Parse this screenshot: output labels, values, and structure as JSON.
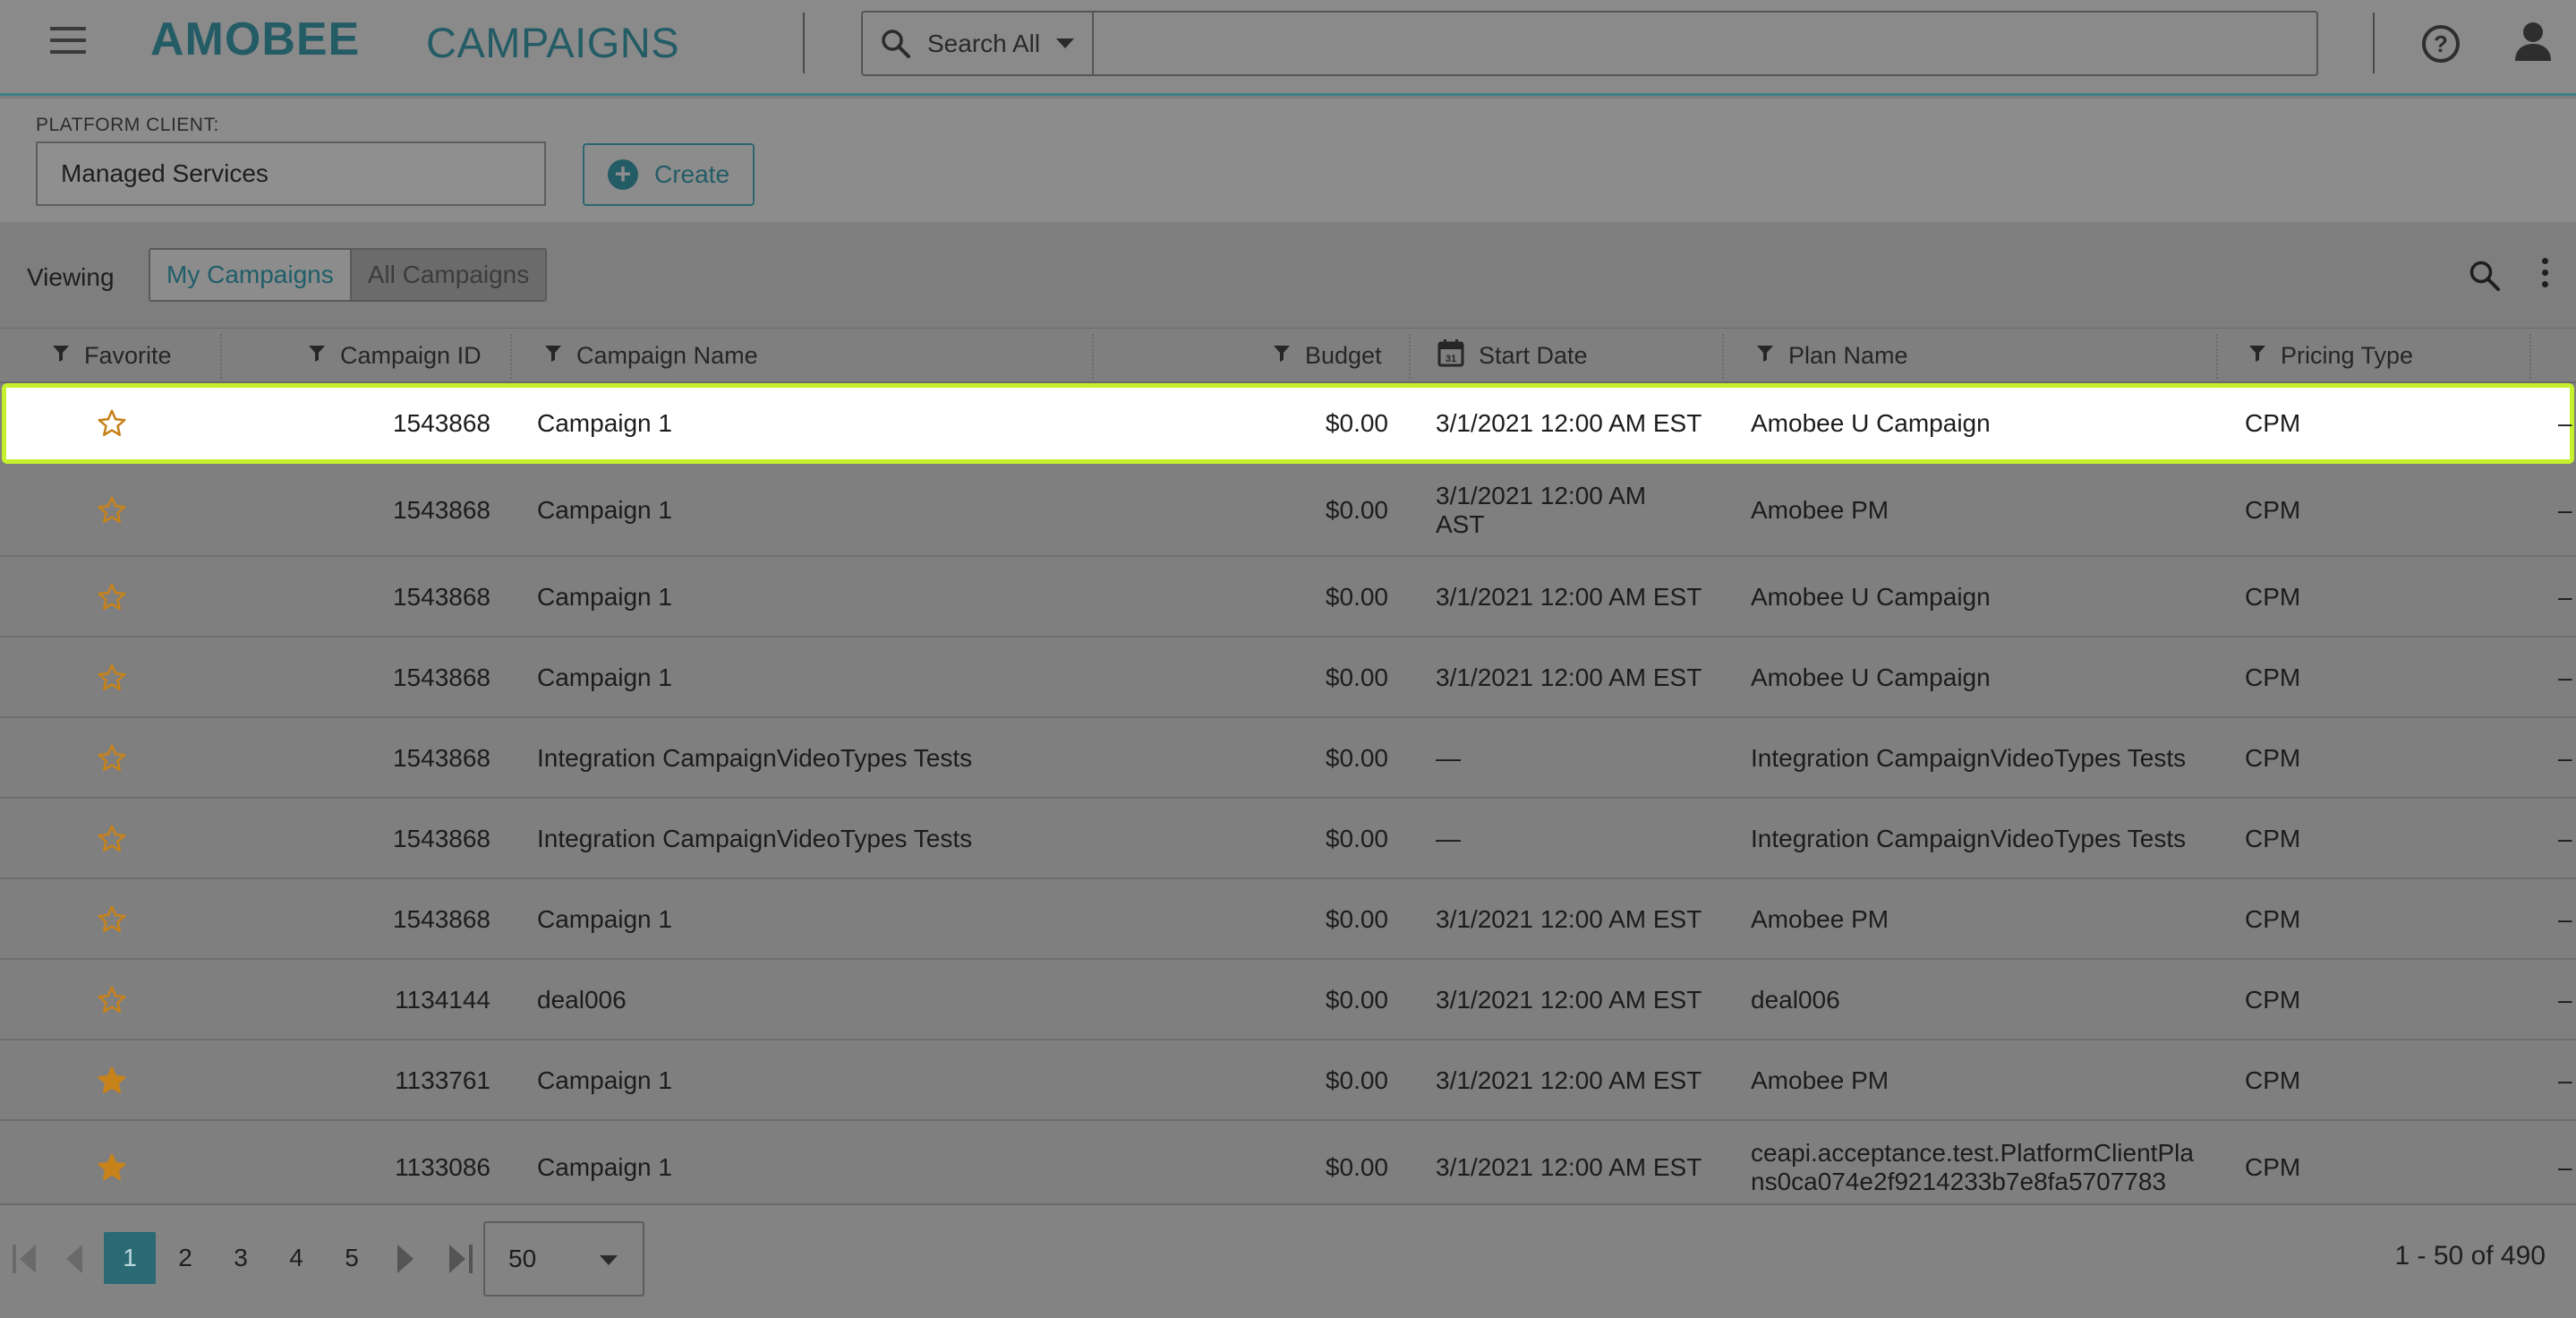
{
  "header": {
    "logo": "AMOBEE",
    "app_title": "CAMPAIGNS",
    "search_scope": "Search All",
    "search_value": "",
    "help_label": "?"
  },
  "client": {
    "label": "PLATFORM CLIENT:",
    "selected": "Managed Services",
    "create_label": "Create"
  },
  "viewing": {
    "label": "Viewing",
    "my_campaigns": "My Campaigns",
    "all_campaigns": "All Campaigns"
  },
  "table": {
    "headers": [
      "Favorite",
      "Campaign ID",
      "Campaign Name",
      "Budget",
      "Start Date",
      "Plan Name",
      "Pricing Type"
    ],
    "rows": [
      {
        "favorite": false,
        "id": "1543868",
        "name": "Campaign 1",
        "budget": "$0.00",
        "start": "3/1/2021 12:00 AM EST",
        "plan": "Amobee U Campaign",
        "pricing": "CPM",
        "extra": "–"
      },
      {
        "favorite": false,
        "id": "1543868",
        "name": "Campaign 1",
        "budget": "$0.00",
        "start": "3/1/2021 12:00 AM AST",
        "plan": "Amobee PM",
        "pricing": "CPM",
        "extra": "–"
      },
      {
        "favorite": false,
        "id": "1543868",
        "name": "Campaign 1",
        "budget": "$0.00",
        "start": "3/1/2021 12:00 AM EST",
        "plan": "Amobee U Campaign",
        "pricing": "CPM",
        "extra": "–"
      },
      {
        "favorite": false,
        "id": "1543868",
        "name": "Campaign 1",
        "budget": "$0.00",
        "start": "3/1/2021 12:00 AM EST",
        "plan": "Amobee U Campaign",
        "pricing": "CPM",
        "extra": "–"
      },
      {
        "favorite": false,
        "id": "1543868",
        "name": "Integration CampaignVideoTypes Tests",
        "budget": "$0.00",
        "start": "—",
        "plan": "Integration CampaignVideoTypes Tests",
        "pricing": "CPM",
        "extra": "–"
      },
      {
        "favorite": false,
        "id": "1543868",
        "name": "Integration CampaignVideoTypes Tests",
        "budget": "$0.00",
        "start": "—",
        "plan": "Integration CampaignVideoTypes Tests",
        "pricing": "CPM",
        "extra": "–"
      },
      {
        "favorite": false,
        "id": "1543868",
        "name": "Campaign 1",
        "budget": "$0.00",
        "start": "3/1/2021 12:00 AM EST",
        "plan": "Amobee PM",
        "pricing": "CPM",
        "extra": "–"
      },
      {
        "favorite": false,
        "id": "1134144",
        "name": "deal006",
        "budget": "$0.00",
        "start": "3/1/2021 12:00 AM EST",
        "plan": "deal006",
        "pricing": "CPM",
        "extra": "–"
      },
      {
        "favorite": true,
        "id": "1133761",
        "name": "Campaign 1",
        "budget": "$0.00",
        "start": "3/1/2021 12:00 AM EST",
        "plan": "Amobee PM",
        "pricing": "CPM",
        "extra": "–"
      },
      {
        "favorite": true,
        "id": "1133086",
        "name": "Campaign 1",
        "budget": "$0.00",
        "start": "3/1/2021 12:00 AM EST",
        "plan": "ceapi.acceptance.test.PlatformClientPlans0ca074e2f9214233b7e8fa5707783",
        "pricing": "CPM",
        "extra": "–"
      }
    ]
  },
  "pager": {
    "pages": [
      "1",
      "2",
      "3",
      "4",
      "5"
    ],
    "current": "1",
    "page_size": "50",
    "range": "1 - 50 of 490"
  },
  "colors": {
    "accent": "#245c66",
    "star": "#c7821a",
    "highlight": "#c6f02c"
  }
}
